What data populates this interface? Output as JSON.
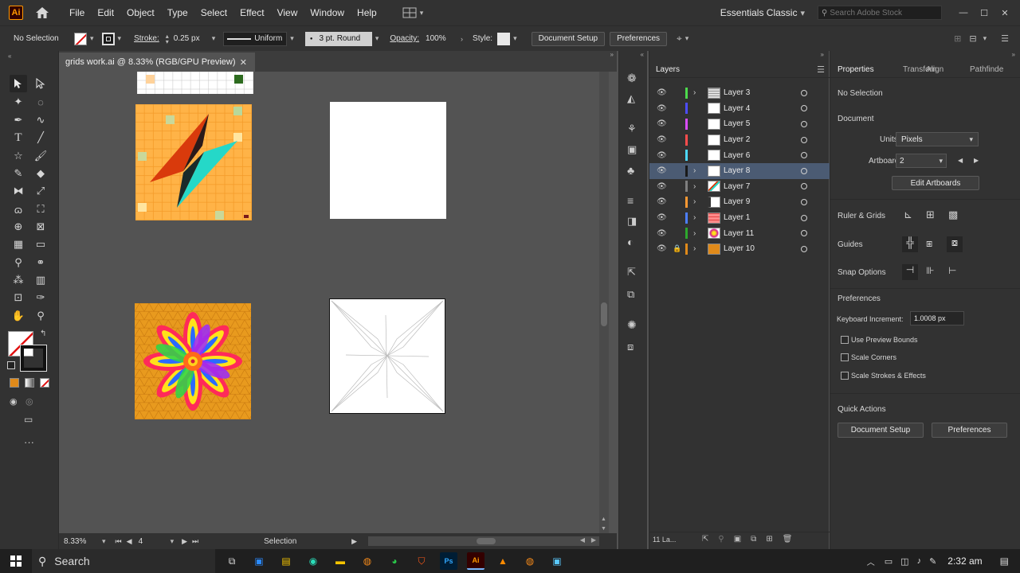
{
  "menubar": {
    "logo": "Ai",
    "items": [
      "File",
      "Edit",
      "Object",
      "Type",
      "Select",
      "Effect",
      "View",
      "Window",
      "Help"
    ],
    "workspace": "Essentials Classic",
    "search_placeholder": "Search Adobe Stock"
  },
  "controlbar": {
    "selection": "No Selection",
    "stroke_label": "Stroke:",
    "stroke_value": "0.25 px",
    "profile": "Uniform",
    "brush": "3 pt. Round",
    "opacity_label": "Opacity:",
    "opacity_value": "100%",
    "style_label": "Style:",
    "document_setup": "Document Setup",
    "preferences": "Preferences"
  },
  "document": {
    "tab_title": "grids work.ai @ 8.33% (RGB/GPU Preview)"
  },
  "statusbar": {
    "zoom": "8.33%",
    "artboard_number": "4",
    "tool": "Selection"
  },
  "layers_panel": {
    "title": "Layers",
    "footer_count": "11 La...",
    "layers": [
      {
        "name": "Layer 3",
        "color": "#4ddb4d",
        "expandable": true,
        "locked": false,
        "selected": false
      },
      {
        "name": "Layer 4",
        "color": "#4d4dff",
        "expandable": false,
        "locked": false,
        "selected": false
      },
      {
        "name": "Layer 5",
        "color": "#d94dff",
        "expandable": false,
        "locked": false,
        "selected": false
      },
      {
        "name": "Layer 2",
        "color": "#ff4d4d",
        "expandable": false,
        "locked": false,
        "selected": false
      },
      {
        "name": "Layer 6",
        "color": "#4dd9ff",
        "expandable": false,
        "locked": false,
        "selected": false
      },
      {
        "name": "Layer 8",
        "color": "#1a1a1a",
        "expandable": true,
        "locked": false,
        "selected": true
      },
      {
        "name": "Layer 7",
        "color": "#7f7f7f",
        "expandable": true,
        "locked": false,
        "selected": false
      },
      {
        "name": "Layer 9",
        "color": "#ff9933",
        "expandable": true,
        "locked": false,
        "selected": false
      },
      {
        "name": "Layer 1",
        "color": "#4d7fff",
        "expandable": true,
        "locked": false,
        "selected": false
      },
      {
        "name": "Layer 11",
        "color": "#2da82d",
        "expandable": true,
        "locked": false,
        "selected": false
      },
      {
        "name": "Layer 10",
        "color": "#e08a1a",
        "expandable": true,
        "locked": true,
        "selected": false
      }
    ]
  },
  "properties_panel": {
    "tabs": [
      "Properties",
      "Transform",
      "Align",
      "Pathfinder"
    ],
    "tabs_display": [
      "Properties",
      "Transforn",
      "Align",
      "Pathfinde"
    ],
    "no_selection": "No Selection",
    "document_label": "Document",
    "units_label": "Units:",
    "units_value": "Pixels",
    "artboard_label": "Artboard:",
    "artboard_value": "2",
    "edit_artboards": "Edit Artboards",
    "ruler_grids": "Ruler & Grids",
    "guides": "Guides",
    "snap_options": "Snap Options",
    "preferences_label": "Preferences",
    "keyboard_increment_label": "Keyboard Increment:",
    "keyboard_increment_value": "1.0008 px",
    "use_preview_bounds": "Use Preview Bounds",
    "scale_corners": "Scale Corners",
    "scale_strokes": "Scale Strokes & Effects",
    "quick_actions": "Quick Actions",
    "document_setup_btn": "Document Setup",
    "preferences_btn": "Preferences"
  },
  "taskbar": {
    "search": "Search",
    "time": "2:32 am"
  }
}
